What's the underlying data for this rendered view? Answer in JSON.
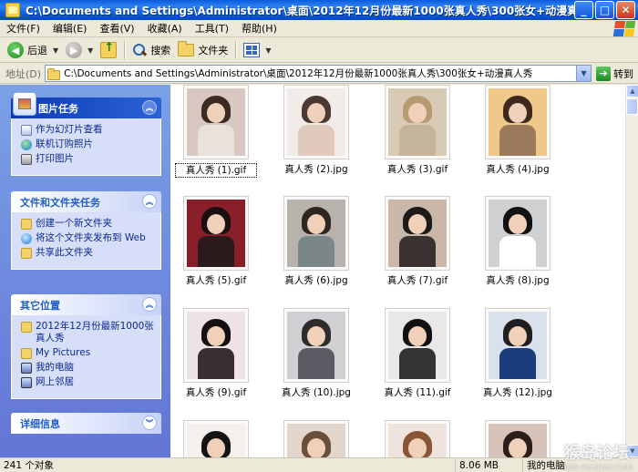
{
  "window": {
    "title": "C:\\Documents and Settings\\Administrator\\桌面\\2012年12月份最新1000张真人秀\\300张女+动漫真..."
  },
  "menu": [
    "文件(F)",
    "编辑(E)",
    "查看(V)",
    "收藏(A)",
    "工具(T)",
    "帮助(H)"
  ],
  "toolbar": {
    "back_label": "后退",
    "search_label": "搜索",
    "folders_label": "文件夹"
  },
  "address": {
    "label": "地址(D)",
    "value": "C:\\Documents and Settings\\Administrator\\桌面\\2012年12月份最新1000张真人秀\\300张女+动漫真人秀",
    "go_label": "转到"
  },
  "tasks": {
    "picture": {
      "title": "图片任务",
      "items": [
        "作为幻灯片查看",
        "联机订购照片",
        "打印图片"
      ]
    },
    "file": {
      "title": "文件和文件夹任务",
      "items": [
        "创建一个新文件夹",
        "将这个文件夹发布到 Web",
        "共享此文件夹"
      ]
    },
    "other": {
      "title": "其它位置",
      "items": [
        "2012年12月份最新1000张真人秀",
        "My Pictures",
        "我的电脑",
        "网上邻居"
      ]
    },
    "details": {
      "title": "详细信息"
    }
  },
  "files": [
    {
      "name": "真人秀 (1).gif",
      "tone": "#d9c8c2",
      "hair": "#3b2a22",
      "body": "#e9e2dc"
    },
    {
      "name": "真人秀 (2).jpg",
      "tone": "#f2ece8",
      "hair": "#4a3a33",
      "body": "#e0c9bd"
    },
    {
      "name": "真人秀 (3).gif",
      "tone": "#d8cab4",
      "hair": "#b89a72",
      "body": "#c5b39a"
    },
    {
      "name": "真人秀 (4).jpg",
      "tone": "#f0c88a",
      "hair": "#3d2a1d",
      "body": "#9b7b5b"
    },
    {
      "name": "真人秀 (5).gif",
      "tone": "#8a1f2a",
      "hair": "#1a1012",
      "body": "#2a1a1c"
    },
    {
      "name": "真人秀 (6).jpg",
      "tone": "#b8b2ad",
      "hair": "#2f2622",
      "body": "#7b8688"
    },
    {
      "name": "真人秀 (7).gif",
      "tone": "#c9b8a9",
      "hair": "#1e1a18",
      "body": "#3a3230"
    },
    {
      "name": "真人秀 (8).jpg",
      "tone": "#cfd0d2",
      "hair": "#111111",
      "body": "#ffffff"
    },
    {
      "name": "真人秀 (9).gif",
      "tone": "#ede3e6",
      "hair": "#141012",
      "body": "#3a2e32"
    },
    {
      "name": "真人秀 (10).jpg",
      "tone": "#cfcfd4",
      "hair": "#2f2b2b",
      "body": "#5b5c63"
    },
    {
      "name": "真人秀 (11).gif",
      "tone": "#e8e8e8",
      "hair": "#111111",
      "body": "#333333"
    },
    {
      "name": "真人秀 (12).jpg",
      "tone": "#d9e2ec",
      "hair": "#1f1f22",
      "body": "#1b3d7c"
    },
    {
      "name": "",
      "tone": "#f4f1ec",
      "hair": "#141414",
      "body": "#f0ebe2"
    },
    {
      "name": "",
      "tone": "#e2d6cc",
      "hair": "#6a4f3a",
      "body": "#d3c4b4"
    },
    {
      "name": "",
      "tone": "#efe4dd",
      "hair": "#8a5436",
      "body": "#e6d3c6"
    },
    {
      "name": "",
      "tone": "#d7c2b8",
      "hair": "#2a1e19",
      "body": "#b89686"
    }
  ],
  "status": {
    "objects": "241 个对象",
    "size": "8.06 MB",
    "location": "我的电脑"
  },
  "watermark": {
    "text": "猴岛论坛",
    "sub": "BBS.HOUDAO.COM"
  },
  "colors": {
    "titlebar": "#0a5bdc",
    "taskpane": "#6f8fde",
    "task_link": "#0c2a8a"
  }
}
